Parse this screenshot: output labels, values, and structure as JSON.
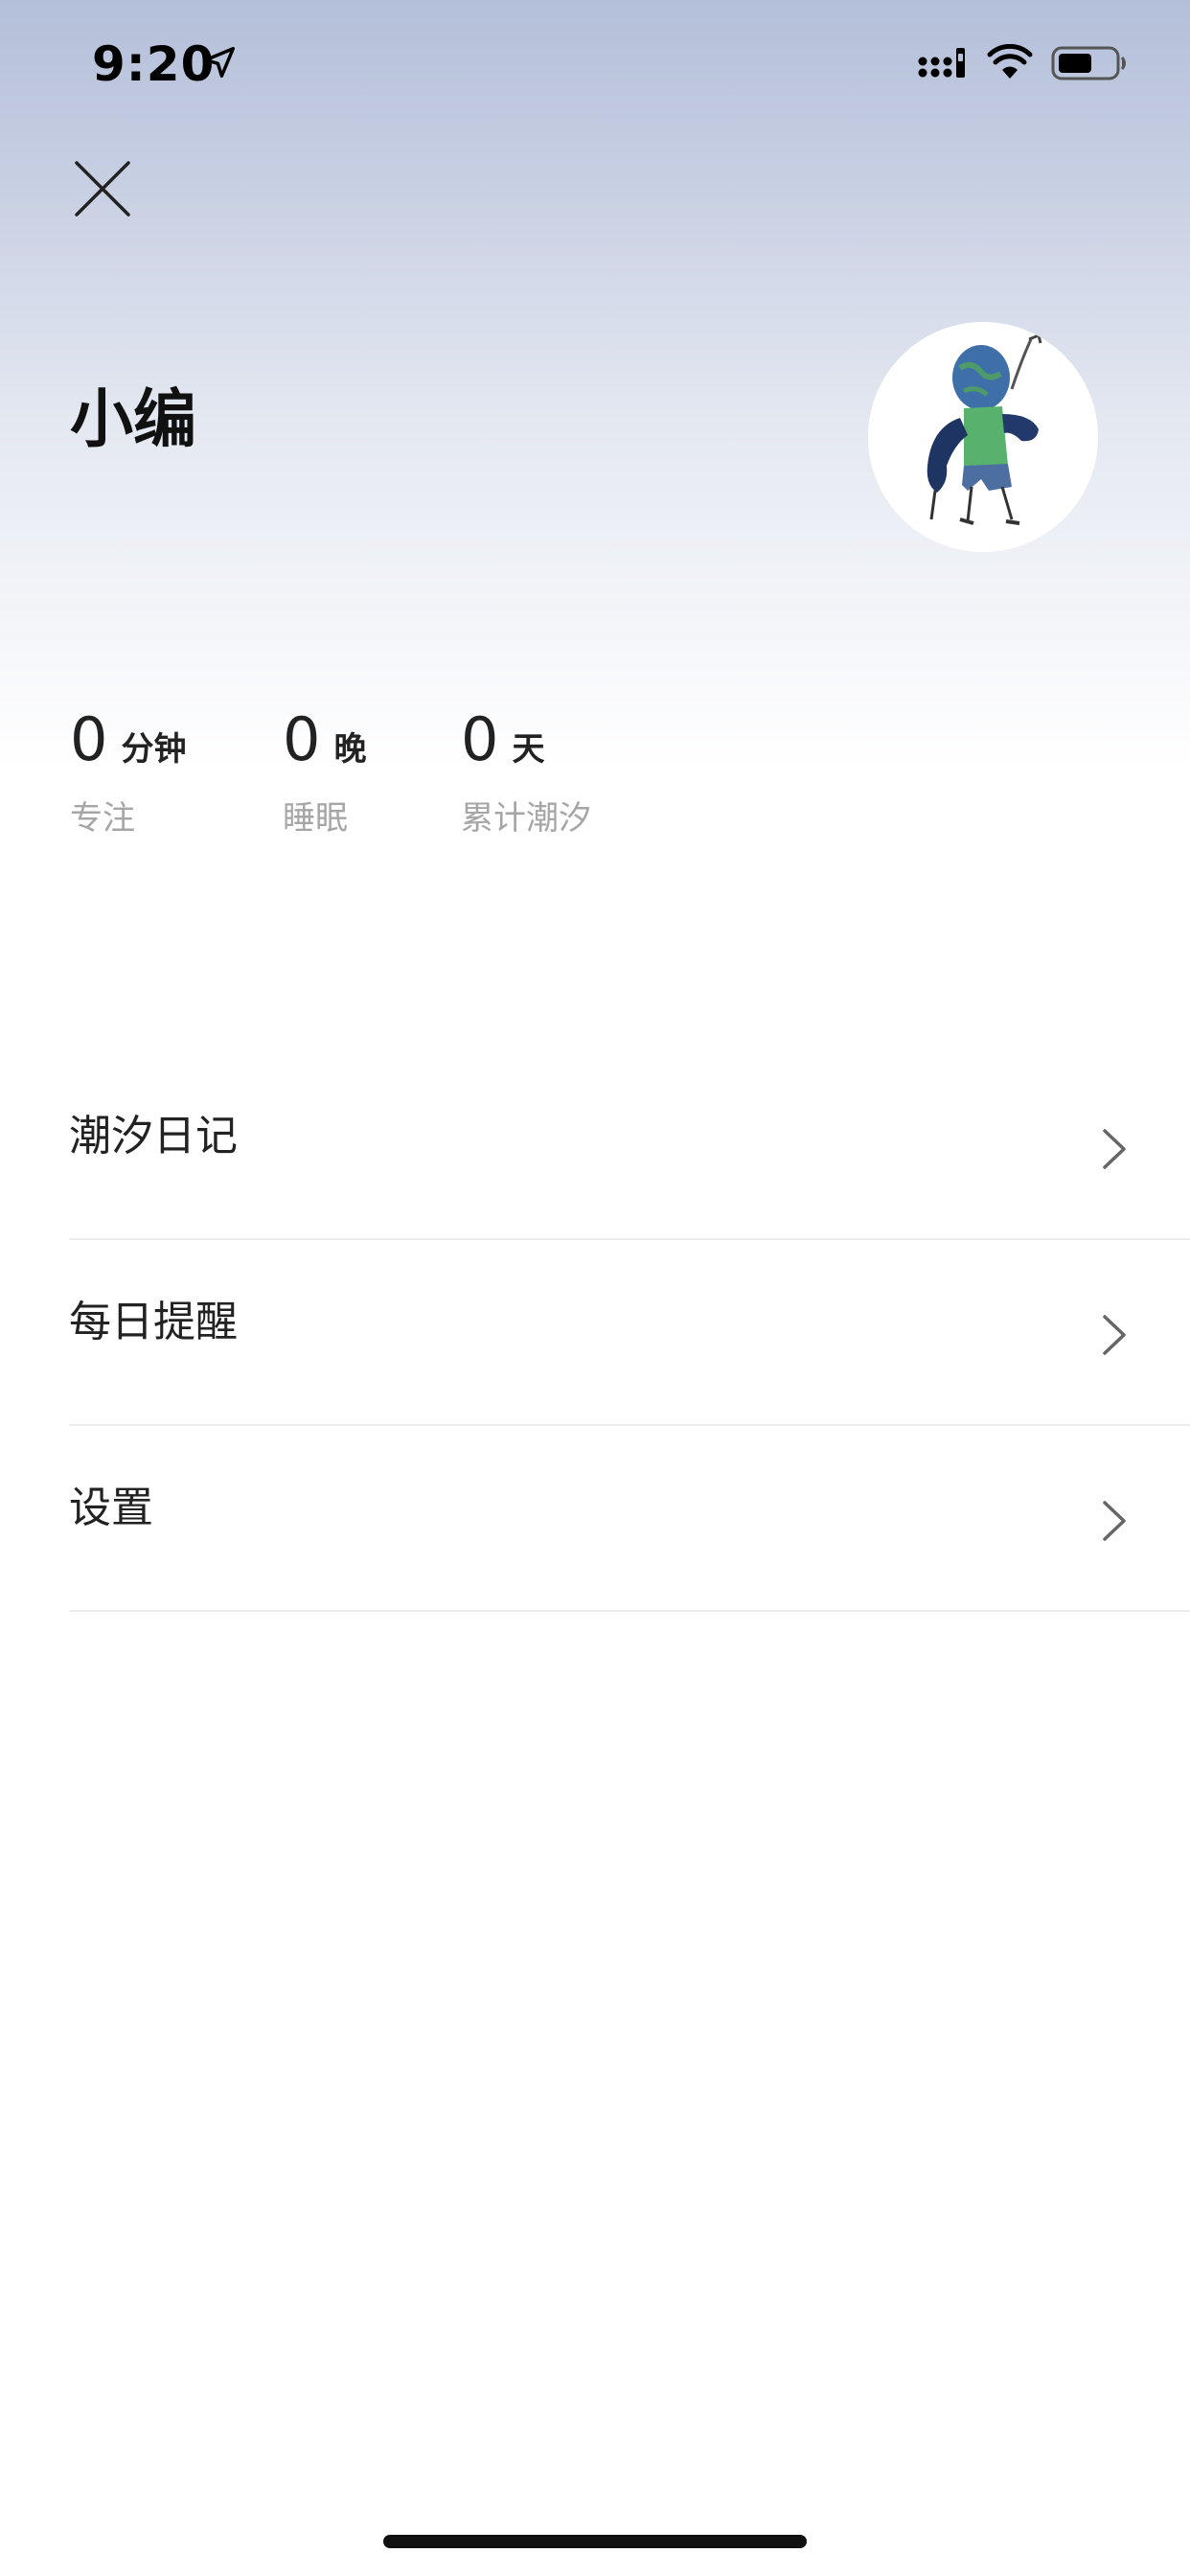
{
  "status_bar": {
    "time": "9:20",
    "icons": [
      "location-arrow-icon",
      "cellular-signal-icon",
      "wifi-icon",
      "battery-icon"
    ]
  },
  "header": {
    "close_icon": "close-icon"
  },
  "profile": {
    "name": "小编",
    "avatar": "avatar-illustration"
  },
  "stats": {
    "focus": {
      "value": "0",
      "unit": "分钟",
      "label": "专注"
    },
    "sleep": {
      "value": "0",
      "unit": "晚",
      "label": "睡眠"
    },
    "tide": {
      "value": "0",
      "unit": "天",
      "label": "累计潮汐"
    }
  },
  "menu": {
    "items": [
      {
        "label": "潮汐日记",
        "icon": "chevron-right-icon"
      },
      {
        "label": "每日提醒",
        "icon": "chevron-right-icon"
      },
      {
        "label": "设置",
        "icon": "chevron-right-icon"
      }
    ]
  },
  "colors": {
    "header_gradient_top": "#b4bfd9",
    "header_gradient_bottom": "#ffffff",
    "secondary_text": "#a6a6a6",
    "divider": "#ececec"
  }
}
